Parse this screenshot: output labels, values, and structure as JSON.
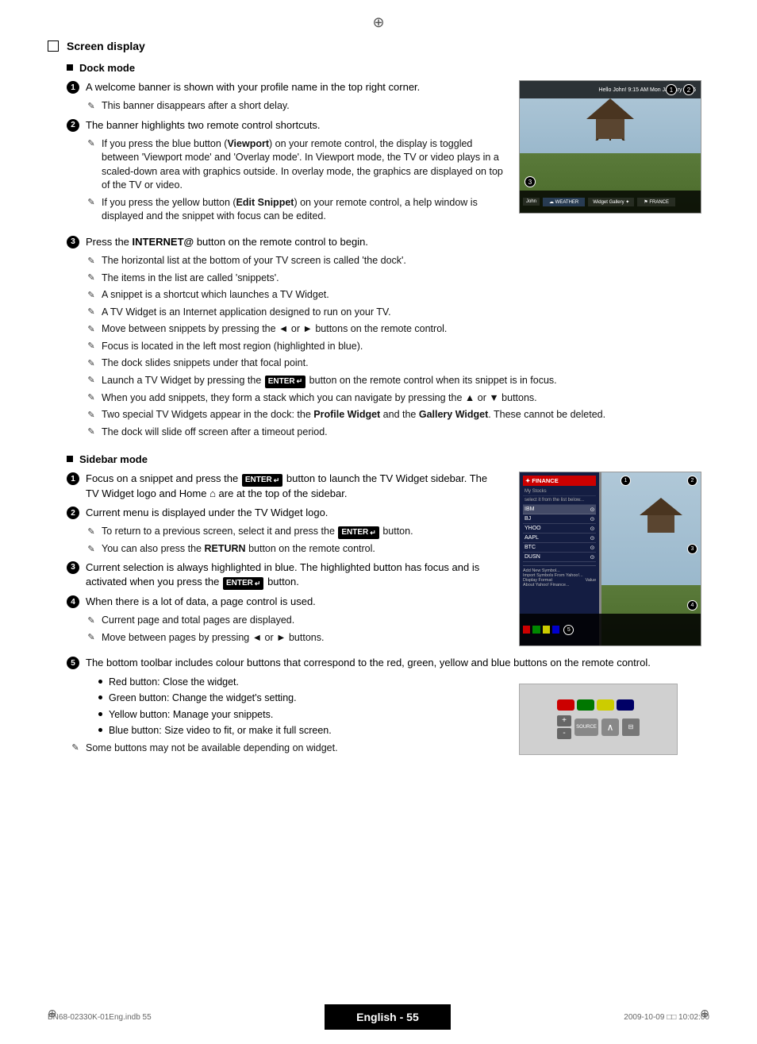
{
  "page": {
    "title": "Screen display",
    "crosshair_top": "⊕",
    "crosshair_bottom_left": "⊕",
    "crosshair_bottom_right": "⊕"
  },
  "footer": {
    "left_text": "BN68-02330K-01Eng.indb   55",
    "center_text": "English - 55",
    "right_text": "2009-10-09   □□   10:02:00"
  },
  "dock_mode": {
    "title": "Dock mode",
    "item1": {
      "text": "A welcome banner is shown with your profile name in the top right corner.",
      "note1": "This banner disappears after a short delay."
    },
    "item2": {
      "text": "The banner highlights two remote control shortcuts.",
      "note1": "If you press the blue button (Viewport) on your remote control, the display is toggled between 'Viewport mode' and 'Overlay mode'. In Viewport mode, the TV or video plays in a scaled-down area with graphics outside. In overlay mode, the graphics are displayed on top of the TV or video.",
      "note2": "If you press the yellow button (Edit Snippet) on your remote control, a help window is displayed and the snippet with focus can be edited."
    },
    "item3": {
      "text": "Press the INTERNET@ button on the remote control to begin.",
      "notes": [
        "The horizontal list at the bottom of your TV screen is called 'the dock'.",
        "The items in the list are called 'snippets'.",
        "A snippet is a shortcut which launches a TV Widget.",
        "A TV Widget is an Internet application designed to run on your TV.",
        "Move between snippets by pressing the ◄ or ► buttons on the remote control.",
        "Focus is located in the left most region (highlighted in blue).",
        "The dock slides snippets under that focal point.",
        "Launch a TV Widget by pressing the ENTER button on the remote control when its snippet is in focus.",
        "When you add snippets, they form a stack which you can navigate by pressing the ▲ or ▼ buttons.",
        "Two special TV Widgets appear in the dock: the Profile Widget and the Gallery Widget. These cannot be deleted.",
        "The dock will slide off screen after a timeout period."
      ]
    }
  },
  "sidebar_mode": {
    "title": "Sidebar mode",
    "item1": {
      "text": "Focus on a snippet and press the ENTER button to launch the TV Widget sidebar. The TV Widget logo and Home are at the top of the sidebar."
    },
    "item2": {
      "text": "Current menu is displayed under the TV Widget logo.",
      "note1": "To return to a previous screen, select it and press the ENTER button.",
      "note2": "You can also press the RETURN button on the remote control."
    },
    "item3": {
      "text": "Current selection is always highlighted in blue. The highlighted button has focus and is activated when you press the ENTER button."
    },
    "item4": {
      "text": "When there is a lot of data, a page control is used.",
      "note1": "Current page and total pages are displayed.",
      "note2": "Move between pages by pressing ◄ or ► buttons."
    },
    "item5": {
      "text": "The bottom toolbar includes colour buttons that correspond to the red, green, yellow and blue buttons on the remote control.",
      "bullets": [
        "Red button: Close the widget.",
        "Green button: Change the widget's setting.",
        "Yellow button: Manage your snippets.",
        "Blue button: Size video to fit, or make it full screen."
      ],
      "note1": "Some buttons may not be available depending on widget."
    }
  },
  "sidebar_panel_items": [
    {
      "label": "FINANCE",
      "selected": true
    },
    {
      "label": "IBM",
      "selected": false
    },
    {
      "label": "BJ",
      "selected": false
    },
    {
      "label": "YHOO",
      "selected": false
    },
    {
      "label": "AAPL",
      "selected": false
    },
    {
      "label": "BTC",
      "selected": false
    },
    {
      "label": "DUSN",
      "selected": false
    }
  ]
}
